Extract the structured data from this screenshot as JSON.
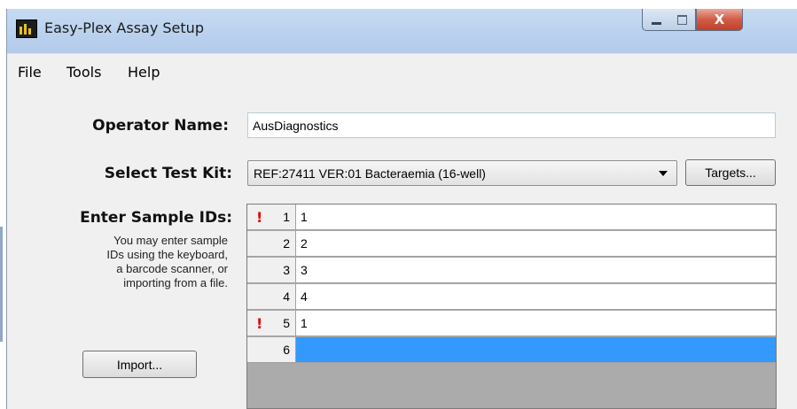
{
  "window": {
    "title": "Easy-Plex Assay Setup"
  },
  "icons": {
    "app": "app-icon",
    "minimize": "minimize-icon",
    "maximize": "maximize-icon",
    "close": "close-icon",
    "warning": "warning-icon",
    "dropdown": "chevron-down-icon"
  },
  "titlebar_buttons": {
    "close_glyph": "X"
  },
  "menu": {
    "items": [
      "File",
      "Tools",
      "Help"
    ]
  },
  "form": {
    "operator_label": "Operator Name:",
    "operator_value": "AusDiagnostics",
    "testkit_label": "Select Test Kit:",
    "testkit_value": "REF:27411 VER:01 Bacteraemia (16-well)",
    "targets_button": "Targets...",
    "samples_label": "Enter Sample IDs:",
    "help_lines": [
      "You may enter sample",
      "IDs using the keyboard,",
      "a barcode scanner, or",
      "importing from a file."
    ],
    "import_button": "Import..."
  },
  "samples": {
    "rows": [
      {
        "num": "1",
        "value": "1",
        "warning": "!"
      },
      {
        "num": "2",
        "value": "2",
        "warning": ""
      },
      {
        "num": "3",
        "value": "3",
        "warning": ""
      },
      {
        "num": "4",
        "value": "4",
        "warning": ""
      },
      {
        "num": "5",
        "value": "1",
        "warning": "!"
      },
      {
        "num": "6",
        "value": "",
        "warning": ""
      }
    ],
    "selected_row": 6,
    "selection_color": "#3399ff",
    "warning_color": "#e00000"
  }
}
